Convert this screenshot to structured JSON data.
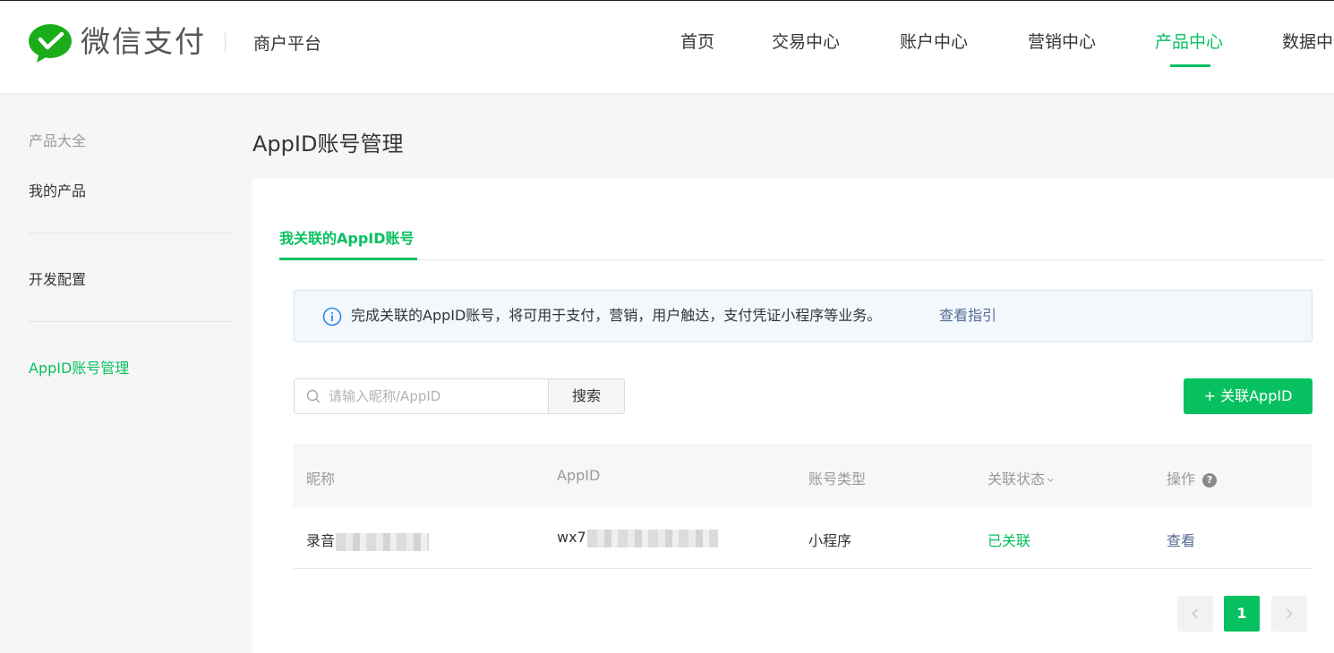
{
  "header": {
    "brand": "微信支付",
    "platform": "商户平台",
    "nav": [
      "首页",
      "交易中心",
      "账户中心",
      "营销中心",
      "产品中心",
      "数据中"
    ],
    "active_nav": "产品中心"
  },
  "sidebar": {
    "section_label": "产品大全",
    "items": [
      "我的产品",
      "开发配置",
      "AppID账号管理"
    ],
    "active_item": "AppID账号管理"
  },
  "main": {
    "title": "AppID账号管理",
    "tab": "我关联的AppID账号",
    "notice": {
      "text": "完成关联的AppID账号，将可用于支付，营销，用户触达，支付凭证小程序等业务。",
      "link": "查看指引"
    },
    "search": {
      "placeholder": "请输入昵称/AppID",
      "button": "搜索"
    },
    "add_button": "+ 关联AppID",
    "table": {
      "headers": [
        "昵称",
        "AppID",
        "账号类型",
        "关联状态",
        "操作"
      ],
      "rows": [
        {
          "nickname": "录音",
          "appid": "wx7",
          "type": "小程序",
          "status": "已关联",
          "action": "查看"
        }
      ]
    },
    "pagination": {
      "current": "1",
      "prev_icon": "chevron-left-icon",
      "next_icon": "chevron-right-icon"
    }
  },
  "colors": {
    "accent": "#07c160",
    "link": "#576b95",
    "notice_bg": "#f3f8fd"
  }
}
